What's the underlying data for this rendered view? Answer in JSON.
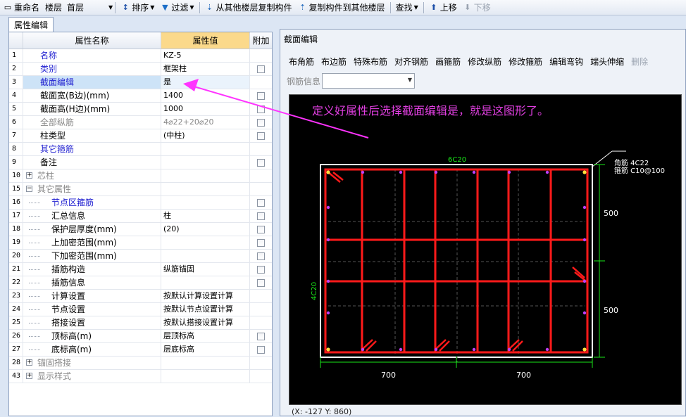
{
  "toolbar": {
    "rename": "重命名",
    "floor_label": "楼层",
    "floor_value": "首层",
    "sort": "排序",
    "filter": "过滤",
    "copy_from_other": "从其他楼层复制构件",
    "copy_to_other": "复制构件到其他楼层",
    "find": "查找",
    "move_up": "上移",
    "move_down": "下移"
  },
  "tab": "属性编辑",
  "grid": {
    "headers": {
      "name": "属性名称",
      "value": "属性值",
      "extra": "附加"
    },
    "rows": [
      {
        "num": "1",
        "name": "名称",
        "value": "KZ-5",
        "style": "blue",
        "indent": 0,
        "cb": false
      },
      {
        "num": "2",
        "name": "类别",
        "value": "框架柱",
        "style": "blue",
        "indent": 0,
        "cb": true
      },
      {
        "num": "3",
        "name": "截面编辑",
        "value": "是",
        "style": "blue",
        "indent": 0,
        "cb": false,
        "selected": true
      },
      {
        "num": "4",
        "name": "截面宽(B边)(mm)",
        "value": "1400",
        "style": "normal",
        "indent": 0,
        "cb": true
      },
      {
        "num": "5",
        "name": "截面高(H边)(mm)",
        "value": "1000",
        "style": "normal",
        "indent": 0,
        "cb": true
      },
      {
        "num": "6",
        "name": "全部纵筋",
        "value": "4⌀22+20⌀20",
        "style": "gray",
        "indent": 0,
        "cb": true
      },
      {
        "num": "7",
        "name": "柱类型",
        "value": "(中柱)",
        "style": "normal",
        "indent": 0,
        "cb": true
      },
      {
        "num": "8",
        "name": "其它箍筋",
        "value": "",
        "style": "blue",
        "indent": 0,
        "cb": false
      },
      {
        "num": "9",
        "name": "备注",
        "value": "",
        "style": "normal",
        "indent": 0,
        "cb": true
      },
      {
        "num": "10",
        "name": "芯柱",
        "value": "",
        "style": "gray",
        "indent": 0,
        "cb": false,
        "expander": "+"
      },
      {
        "num": "15",
        "name": "其它属性",
        "value": "",
        "style": "gray",
        "indent": 0,
        "cb": false,
        "expander": "−"
      },
      {
        "num": "16",
        "name": "节点区箍筋",
        "value": "",
        "style": "blue",
        "indent": 1,
        "cb": true
      },
      {
        "num": "17",
        "name": "汇总信息",
        "value": "柱",
        "style": "normal",
        "indent": 1,
        "cb": true
      },
      {
        "num": "18",
        "name": "保护层厚度(mm)",
        "value": "(20)",
        "style": "normal",
        "indent": 1,
        "cb": true
      },
      {
        "num": "19",
        "name": "上加密范围(mm)",
        "value": "",
        "style": "normal",
        "indent": 1,
        "cb": true
      },
      {
        "num": "20",
        "name": "下加密范围(mm)",
        "value": "",
        "style": "normal",
        "indent": 1,
        "cb": true
      },
      {
        "num": "21",
        "name": "插筋构造",
        "value": "纵筋锚固",
        "style": "normal",
        "indent": 1,
        "cb": true
      },
      {
        "num": "22",
        "name": "插筋信息",
        "value": "",
        "style": "normal",
        "indent": 1,
        "cb": true
      },
      {
        "num": "23",
        "name": "计算设置",
        "value": "按默认计算设置计算",
        "style": "normal",
        "indent": 1,
        "cb": false
      },
      {
        "num": "24",
        "name": "节点设置",
        "value": "按默认节点设置计算",
        "style": "normal",
        "indent": 1,
        "cb": false
      },
      {
        "num": "25",
        "name": "搭接设置",
        "value": "按默认搭接设置计算",
        "style": "normal",
        "indent": 1,
        "cb": false
      },
      {
        "num": "26",
        "name": "顶标高(m)",
        "value": "层顶标高",
        "style": "normal",
        "indent": 1,
        "cb": true
      },
      {
        "num": "27",
        "name": "底标高(m)",
        "value": "层底标高",
        "style": "normal",
        "indent": 1,
        "cb": true
      },
      {
        "num": "28",
        "name": "锚固搭接",
        "value": "",
        "style": "gray",
        "indent": 0,
        "cb": false,
        "expander": "+"
      },
      {
        "num": "43",
        "name": "显示样式",
        "value": "",
        "style": "gray",
        "indent": 0,
        "cb": false,
        "expander": "+"
      }
    ]
  },
  "dialog": {
    "title": "截面编辑",
    "tools": [
      "布角筋",
      "布边筋",
      "特殊布筋",
      "对齐钢筋",
      "画箍筋",
      "修改纵筋",
      "修改箍筋",
      "编辑弯钩",
      "端头伸缩",
      "删除"
    ],
    "rebar_info_label": "钢筋信息",
    "annotation": "定义好属性后选择截面编辑是，就是这图形了。",
    "corner_label_1": "角筋 4C22",
    "corner_label_2": "箍筋 C10@100",
    "top_bar_label": "6C20",
    "left_bar_label": "4C20",
    "dim_bottom_1": "700",
    "dim_bottom_2": "700",
    "dim_right_1": "500",
    "dim_right_2": "500",
    "status": "(X: -127 Y: 860)"
  },
  "colors": {
    "annotation": "#e23fe2",
    "stirrup": "#ff1a1a",
    "dimension": "#19e619",
    "arrow": "#ff33ff"
  }
}
